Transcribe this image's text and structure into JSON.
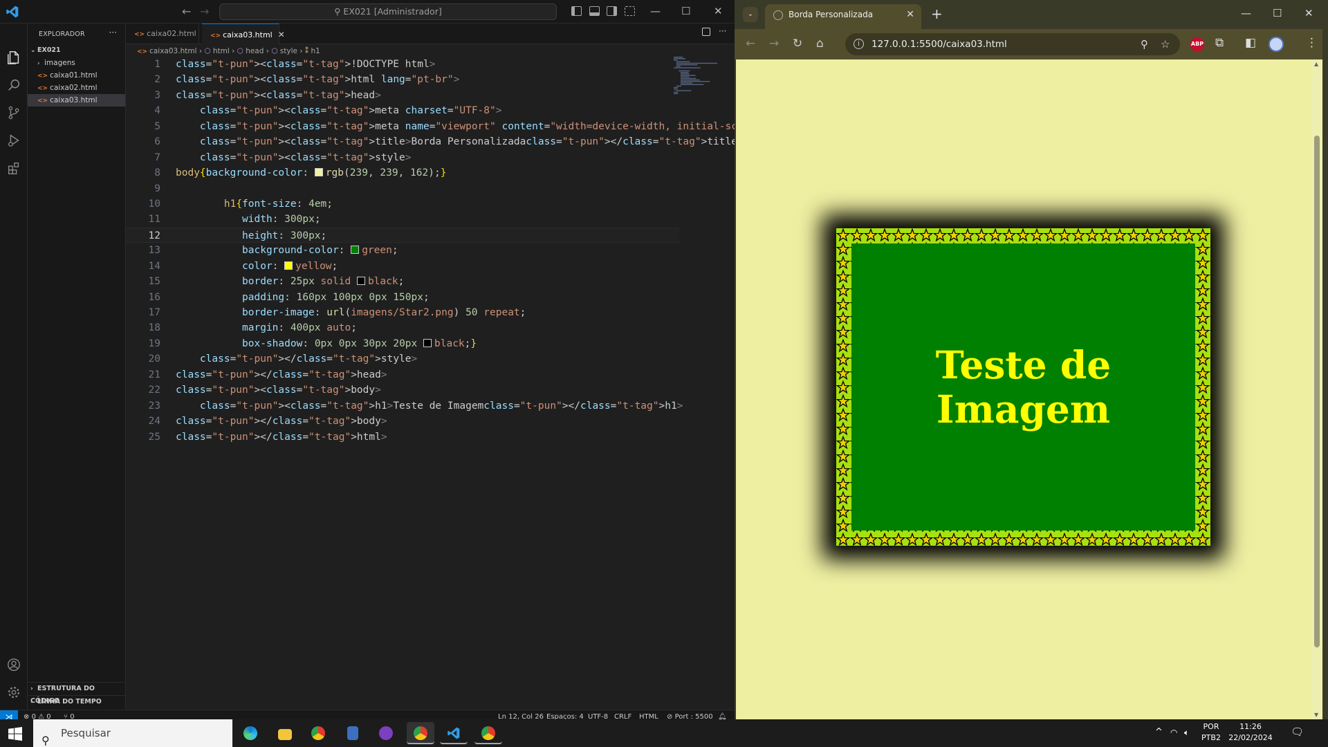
{
  "vscode": {
    "command_center": "EX021 [Administrador]",
    "sidebar": {
      "title": "EXPLORADOR",
      "folder": "EX021",
      "items": [
        {
          "label": "imagens",
          "type": "folder"
        },
        {
          "label": "caixa01.html",
          "type": "file"
        },
        {
          "label": "caixa02.html",
          "type": "file"
        },
        {
          "label": "caixa03.html",
          "type": "file",
          "selected": true
        }
      ],
      "outline": "ESTRUTURA DO CÓDIGO",
      "timeline": "LINHA DO TEMPO"
    },
    "tabs": [
      {
        "label": "caixa02.html",
        "active": false
      },
      {
        "label": "caixa03.html",
        "active": true
      }
    ],
    "breadcrumb": [
      "caixa03.html",
      "html",
      "head",
      "style",
      "h1"
    ],
    "code_lines": [
      "<!DOCTYPE html>",
      "<html lang=\"pt-br\">",
      "<head>",
      "    <meta charset=\"UTF-8\">",
      "    <meta name=\"viewport\" content=\"width=device-width, initial-scale=1.0\">",
      "    <title>Borda Personalizada</title>",
      "    <style>",
      "body{background-color: rgb(239, 239, 162);}",
      "",
      "        h1{font-size: 4em;",
      "           width: 300px;",
      "           height: 300px;",
      "           background-color: green;",
      "           color: yellow;",
      "           border: 25px solid black;",
      "           padding: 160px 100px 0px 150px;",
      "           border-image: url(imagens/Star2.png) 50 repeat;",
      "           margin: 400px auto;",
      "           box-shadow: 0px 0px 30px 20px black;}",
      "    </style>",
      "</head>",
      "<body>",
      "    <h1>Teste de Imagem</h1>",
      "</body>",
      "</html>"
    ],
    "current_line": 12,
    "status": {
      "errors": "0",
      "warnings": "0",
      "ports": "0",
      "position": "Ln 12, Col 26",
      "spaces": "Espaços: 4",
      "encoding": "UTF-8",
      "eol": "CRLF",
      "language": "HTML",
      "port": "Port : 5500"
    }
  },
  "browser": {
    "tab_title": "Borda Personalizada",
    "url": "127.0.0.1:5500/caixa03.html",
    "abp": "ABP",
    "page_heading": "Teste de Imagem",
    "page_bg": "#efefa2",
    "box_bg": "#008000",
    "text_color": "#ffff00"
  },
  "taskbar": {
    "search_placeholder": "Pesquisar",
    "lang_top": "POR",
    "lang_bottom": "PTB2",
    "time": "11:26",
    "date": "22/02/2024"
  }
}
